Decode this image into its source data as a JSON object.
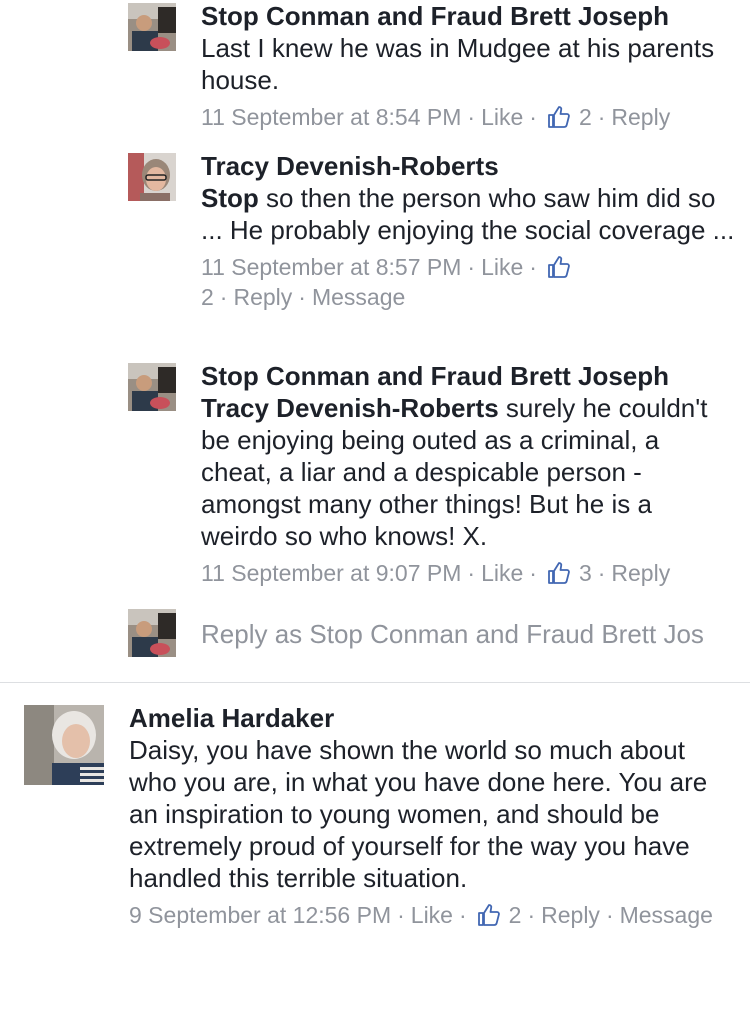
{
  "comments": [
    {
      "author": "Stop Conman and Fraud Brett Joseph",
      "text": "Last I knew he was in Mudgee at his parents house.",
      "timestamp": "11 September at 8:54 PM",
      "like_label": "Like",
      "like_count": "2",
      "reply_label": "Reply"
    },
    {
      "author": "Tracy Devenish-Roberts",
      "mention": "Stop",
      "text": " so then the person who saw him did so ... He probably enjoying the social coverage ...",
      "timestamp": "11 September at 8:57 PM",
      "like_label": "Like",
      "like_count": "2",
      "reply_label": "Reply",
      "message_label": "Message"
    },
    {
      "author": "Stop Conman and Fraud Brett Joseph",
      "mention": "Tracy Devenish-Roberts",
      "text": " surely he couldn't be enjoying being outed as a criminal, a cheat, a liar and a despicable person - amongst many other things! But he is a weirdo so who knows! X.",
      "timestamp": "11 September at 9:07 PM",
      "like_label": "Like",
      "like_count": "3",
      "reply_label": "Reply"
    },
    {
      "author": "Amelia Hardaker",
      "text": "Daisy, you have shown the world so much about who you are, in what you have done here. You are an inspiration to young women, and should be extremely proud of yourself for the way you have handled this terrible situation.",
      "timestamp": "9 September at 12:56 PM",
      "like_label": "Like",
      "like_count": "2",
      "reply_label": "Reply",
      "message_label": "Message"
    }
  ],
  "reply_box": {
    "placeholder": "Reply as Stop Conman and Fraud Brett Jos"
  },
  "separator": "·",
  "icons": {
    "like": "thumbs-up-icon"
  },
  "colors": {
    "meta": "#90949c",
    "like_icon": "#4267b2",
    "text": "#1d2129"
  }
}
